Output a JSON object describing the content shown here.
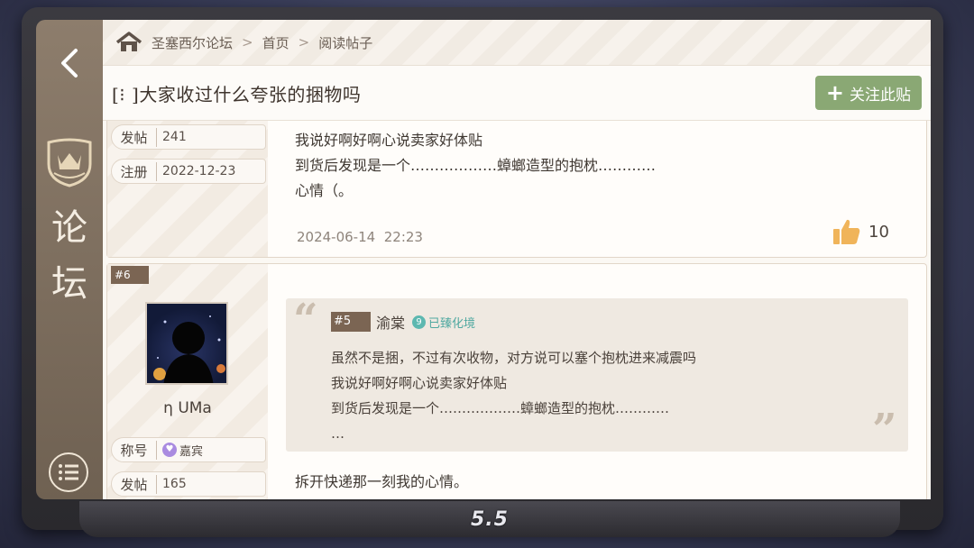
{
  "breadcrumb": {
    "forum": "圣塞西尔论坛",
    "home": "首页",
    "current": "阅读帖子"
  },
  "rail": {
    "title_line1": "论",
    "title_line2": "坛"
  },
  "thread": {
    "title": "[⁝ ]大家收过什么夸张的捆物吗",
    "follow_label": "关注此贴"
  },
  "post1": {
    "posts_label": "发帖",
    "posts_value": "241",
    "reg_label": "注册",
    "reg_value": "2022-12-23",
    "body_lines": [
      "我说好啊好啊心说卖家好体贴",
      "到货后发现是一个………………蟑螂造型的抱枕…………",
      "心情（。"
    ],
    "date": "2024-06-14",
    "time": "22:23",
    "likes": "10"
  },
  "post2": {
    "floor": "#6",
    "username": "η UMa",
    "title_label": "称号",
    "title_value": "嘉宾",
    "posts_label": "发帖",
    "posts_value": "165",
    "quote": {
      "floor": "#5",
      "author": "渝棠",
      "status": "已臻化境",
      "lines": [
        "虽然不是捆，不过有次收物，对方说可以塞个抱枕进来减震吗",
        "我说好啊好啊心说卖家好体贴",
        "到货后发现是一个………………蟑螂造型的抱枕…………",
        "…"
      ]
    },
    "body": "拆开快递那一刻我的心情。"
  },
  "footer": {
    "version": "5.5"
  },
  "colors": {
    "accent": "#8aa874",
    "rail": "#7f7060",
    "floor_tag": "#7b6553"
  }
}
